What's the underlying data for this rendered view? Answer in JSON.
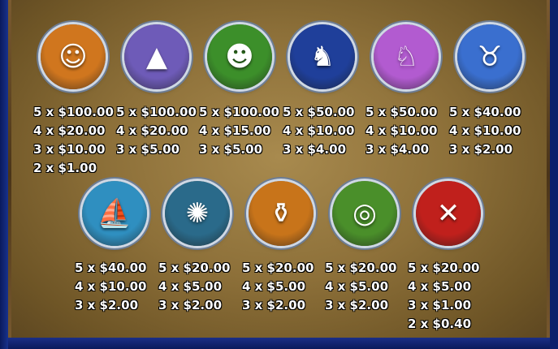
{
  "colors": {
    "panel": "#8d7039",
    "frame": "#0c1f6b",
    "text": "#ffffff"
  },
  "symbols_row1": [
    {
      "name": "chief",
      "icon": "chief-icon",
      "glyph": "☺",
      "bg": "#d0761e",
      "pays": [
        "5 x $100.00",
        "4 x $20.00",
        "3 x $10.00",
        "2 x $1.00"
      ]
    },
    {
      "name": "tipi",
      "icon": "tipi-icon",
      "glyph": "▲",
      "bg": "#6e5bb8",
      "pays": [
        "5 x $100.00",
        "4 x $20.00",
        "3 x $5.00"
      ]
    },
    {
      "name": "woman",
      "icon": "woman-icon",
      "glyph": "☻",
      "bg": "#3c8f2a",
      "pays": [
        "5 x $100.00",
        "4 x $15.00",
        "3 x $5.00"
      ]
    },
    {
      "name": "wolf",
      "icon": "wolf-icon",
      "glyph": "♞",
      "bg": "#1f3f9a",
      "pays": [
        "5 x $50.00",
        "4 x $10.00",
        "3 x $4.00"
      ]
    },
    {
      "name": "horse",
      "icon": "horse-icon",
      "glyph": "♘",
      "bg": "#b25bd0",
      "pays": [
        "5 x $50.00",
        "4 x $10.00",
        "3 x $4.00"
      ]
    },
    {
      "name": "buffalo",
      "icon": "buffalo-icon",
      "glyph": "♉",
      "bg": "#3a6fcf",
      "pays": [
        "5 x $40.00",
        "4 x $10.00",
        "3 x $2.00"
      ]
    }
  ],
  "symbols_row2": [
    {
      "name": "canoe",
      "icon": "canoe-icon",
      "glyph": "⛵",
      "bg": "#2f8fc0",
      "pays": [
        "5 x $40.00",
        "4 x $10.00",
        "3 x $2.00"
      ]
    },
    {
      "name": "dreamcatcher",
      "icon": "dreamcatcher-icon",
      "glyph": "✺",
      "bg": "#2a6a8a",
      "pays": [
        "5 x $20.00",
        "4 x $5.00",
        "3 x $2.00"
      ]
    },
    {
      "name": "pottery",
      "icon": "pottery-icon",
      "glyph": "⚱",
      "bg": "#c8741a",
      "pays": [
        "5 x $20.00",
        "4 x $5.00",
        "3 x $2.00"
      ]
    },
    {
      "name": "drum",
      "icon": "drum-icon",
      "glyph": "◎",
      "bg": "#4a8f2a",
      "pays": [
        "5 x $20.00",
        "4 x $5.00",
        "3 x $2.00"
      ]
    },
    {
      "name": "tomahawks",
      "icon": "tomahawks-icon",
      "glyph": "✕",
      "bg": "#c0201c",
      "pays": [
        "5 x $20.00",
        "4 x $5.00",
        "3 x $1.00",
        "2 x $0.40"
      ]
    }
  ]
}
